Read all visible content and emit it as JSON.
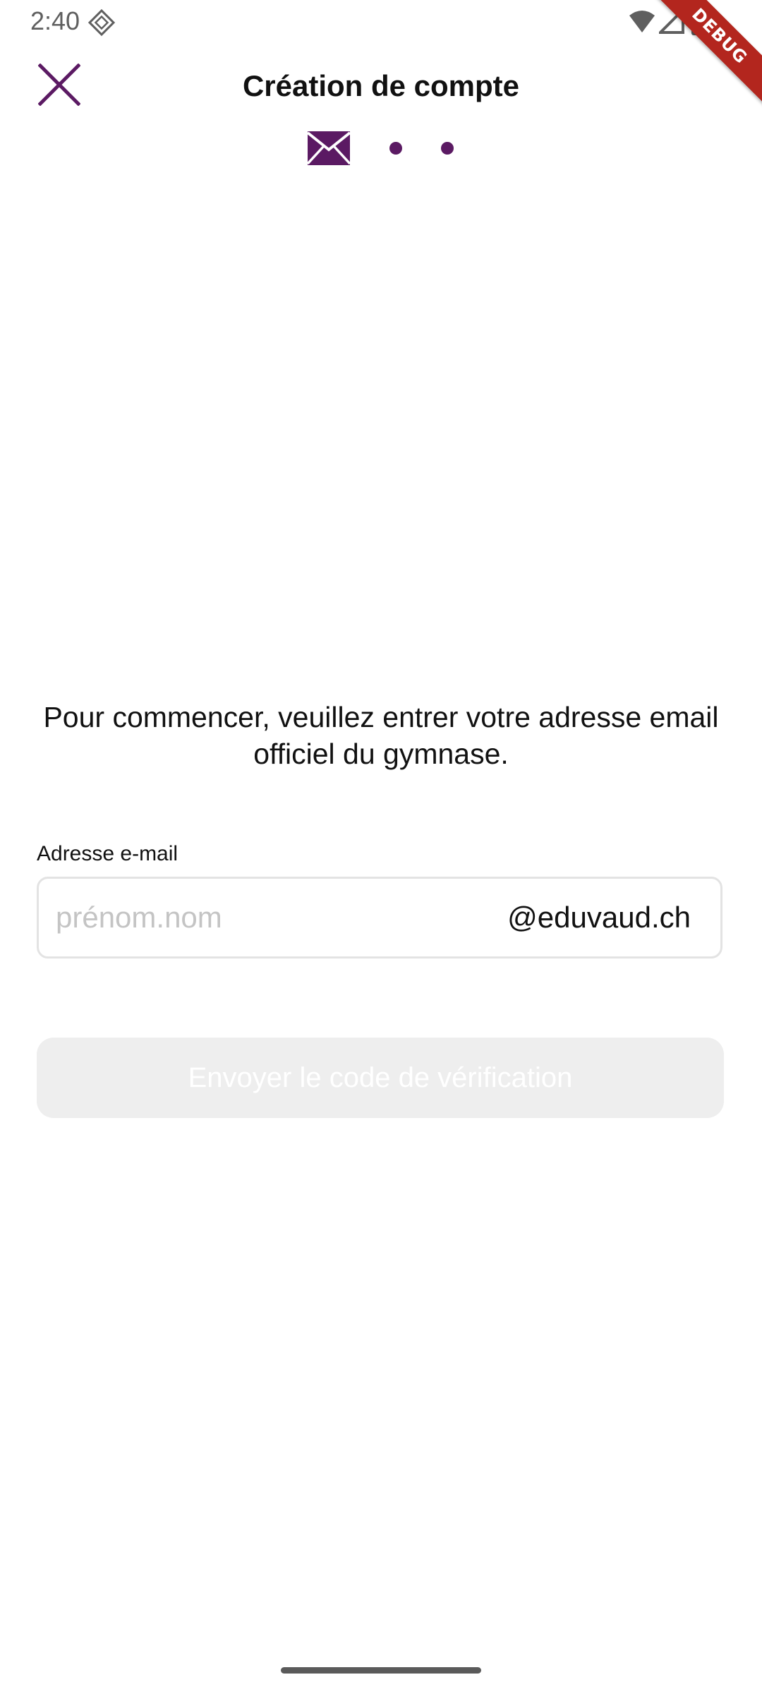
{
  "status_bar": {
    "time": "2:40",
    "icons": [
      "diamond-notification-icon",
      "wifi-icon",
      "cell-signal-icon",
      "battery-icon"
    ]
  },
  "debug_banner": "DEBUG",
  "header": {
    "title": "Création de compte",
    "close_icon": "close-icon"
  },
  "steps": {
    "current_icon": "envelope-icon",
    "total": 3,
    "current": 1
  },
  "instruction": "Pour commencer, veuillez entrer votre adresse email officiel du gymnase.",
  "email_field": {
    "label": "Adresse e-mail",
    "placeholder": "prénom.nom",
    "value": "",
    "suffix": "@eduvaud.ch"
  },
  "submit_button": {
    "label": "Envoyer le code de vérification",
    "enabled": false
  },
  "colors": {
    "accent": "#5b1a63",
    "button_disabled_bg": "#eeeeee",
    "placeholder": "#c4c4c4",
    "debug_banner": "#b3261e"
  }
}
